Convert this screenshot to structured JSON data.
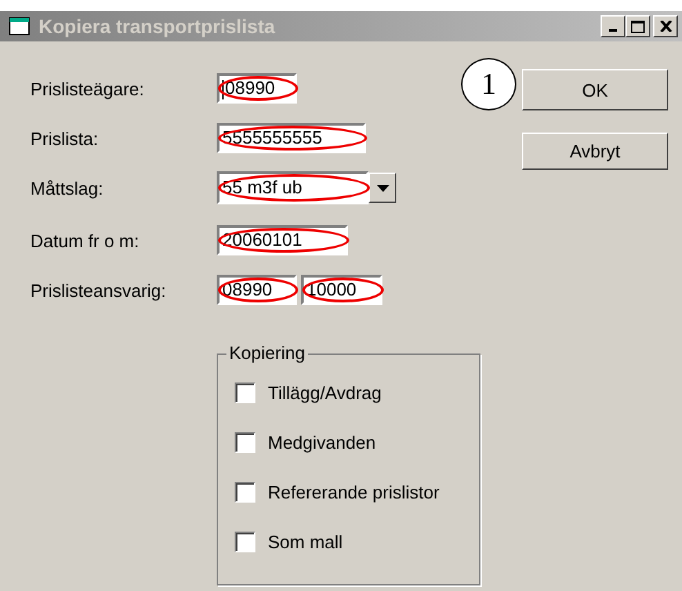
{
  "window": {
    "title": "Kopiera transportprislista"
  },
  "fields": [
    {
      "label": "Prislisteägare:",
      "kind": "text",
      "boxes": [
        {
          "value": "08990",
          "focused": true,
          "circled": true
        }
      ]
    },
    {
      "label": "Prislista:",
      "kind": "text",
      "boxes": [
        {
          "value": "5555555555",
          "focused": false,
          "circled": true
        }
      ]
    },
    {
      "label": "Måttslag:",
      "kind": "dropdown",
      "boxes": [
        {
          "value": "55 m3f ub",
          "focused": false,
          "circled": true
        }
      ]
    },
    {
      "label": "Datum fr o m:",
      "kind": "text",
      "boxes": [
        {
          "value": "20060101",
          "focused": false,
          "circled": true
        }
      ]
    },
    {
      "label": "Prislisteansvarig:",
      "kind": "text",
      "boxes": [
        {
          "value": "08990",
          "focused": false,
          "circled": true
        },
        {
          "value": "10000",
          "focused": false,
          "circled": true
        }
      ]
    }
  ],
  "buttons": [
    {
      "label": "OK",
      "callout": "1"
    },
    {
      "label": "Avbryt"
    }
  ],
  "group": {
    "title": "Kopiering",
    "options": [
      {
        "label": "Tillägg/Avdrag",
        "checked": false
      },
      {
        "label": "Medgivanden",
        "checked": false
      },
      {
        "label": "Refererande prislistor",
        "checked": false
      },
      {
        "label": "Som mall",
        "checked": false
      }
    ]
  }
}
